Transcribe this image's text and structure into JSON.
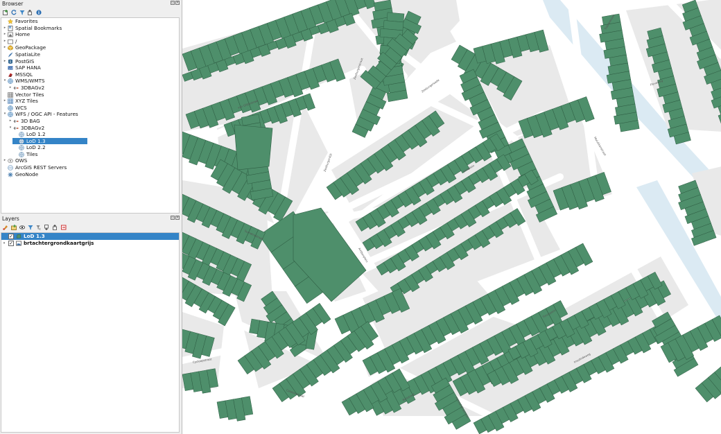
{
  "browser_panel": {
    "title": "Browser",
    "items": [
      {
        "label": "Favorites",
        "level": 0,
        "arrow": "",
        "icon": "star-icon"
      },
      {
        "label": "Spatial Bookmarks",
        "level": 0,
        "arrow": "▸",
        "icon": "bookmark-icon"
      },
      {
        "label": "Home",
        "level": 0,
        "arrow": "▸",
        "icon": "home-folder-icon"
      },
      {
        "label": "/",
        "level": 0,
        "arrow": "▸",
        "icon": "folder-icon"
      },
      {
        "label": "GeoPackage",
        "level": 0,
        "arrow": "▸",
        "icon": "geopackage-icon"
      },
      {
        "label": "SpatiaLite",
        "level": 0,
        "arrow": "",
        "icon": "spatialite-icon"
      },
      {
        "label": "PostGIS",
        "level": 0,
        "arrow": "▸",
        "icon": "postgis-icon"
      },
      {
        "label": "SAP HANA",
        "level": 0,
        "arrow": "",
        "icon": "saphana-icon"
      },
      {
        "label": "MSSQL",
        "level": 0,
        "arrow": "",
        "icon": "mssql-icon"
      },
      {
        "label": "WMS/WMTS",
        "level": 0,
        "arrow": "▾",
        "icon": "globe-icon"
      },
      {
        "label": "3DBAGv2",
        "level": 1,
        "arrow": "▸",
        "icon": "wms-connection-icon"
      },
      {
        "label": "Vector Tiles",
        "level": 0,
        "arrow": "",
        "icon": "vector-tiles-icon"
      },
      {
        "label": "XYZ Tiles",
        "level": 0,
        "arrow": "▸",
        "icon": "xyz-tiles-icon"
      },
      {
        "label": "WCS",
        "level": 0,
        "arrow": "",
        "icon": "globe-icon"
      },
      {
        "label": "WFS / OGC API - Features",
        "level": 0,
        "arrow": "▾",
        "icon": "globe-icon"
      },
      {
        "label": "3D BAG",
        "level": 1,
        "arrow": "▸",
        "icon": "wfs-connection-icon"
      },
      {
        "label": "3DBAGv2",
        "level": 1,
        "arrow": "▾",
        "icon": "wfs-connection-icon"
      },
      {
        "label": "LoD 1.2",
        "level": 2,
        "arrow": "",
        "icon": "layer-globe-icon"
      },
      {
        "label": "LoD 1.3",
        "level": 2,
        "arrow": "",
        "icon": "layer-globe-icon",
        "selected": true
      },
      {
        "label": "LoD 2.2",
        "level": 2,
        "arrow": "",
        "icon": "layer-globe-icon"
      },
      {
        "label": "Tiles",
        "level": 2,
        "arrow": "",
        "icon": "layer-globe-icon"
      },
      {
        "label": "OWS",
        "level": 0,
        "arrow": "▸",
        "icon": "ows-icon"
      },
      {
        "label": "ArcGIS REST Servers",
        "level": 0,
        "arrow": "",
        "icon": "arcgis-icon"
      },
      {
        "label": "GeoNode",
        "level": 0,
        "arrow": "",
        "icon": "geonode-icon"
      }
    ]
  },
  "layers_panel": {
    "title": "Layers",
    "layers": [
      {
        "label": "LoD 1.3",
        "checked": true,
        "selected": true,
        "icon": "polygon-layer-icon"
      },
      {
        "label": "brtachtergrondkaartgrijs",
        "checked": true,
        "selected": false,
        "icon": "raster-layer-icon",
        "arrow": "▾"
      }
    ]
  },
  "map": {
    "building_color": "#4e8f6b",
    "building_stroke": "#2f5e44",
    "block_color": "#e9e9e9",
    "water_color": "#dbeaf3",
    "street_labels": [
      {
        "text": "van Glijdsstraat"
      },
      {
        "text": "Zeeburgerstraat"
      },
      {
        "text": "Zeeburgerdijk"
      },
      {
        "text": "Zeeburgerkade"
      },
      {
        "text": "Javaplein"
      },
      {
        "text": "Ambonplein"
      },
      {
        "text": "Sumatrastraat"
      },
      {
        "text": "Molukkenstraat"
      },
      {
        "text": "Tidorestraat"
      },
      {
        "text": "Flevoweg"
      },
      {
        "text": "Cycloopstraat"
      },
      {
        "text": "Celebesstraat"
      },
      {
        "text": "Balistraat"
      },
      {
        "text": "Halmaheirastraat"
      },
      {
        "text": "Insulindeweg"
      },
      {
        "text": "Timorplein"
      }
    ]
  }
}
